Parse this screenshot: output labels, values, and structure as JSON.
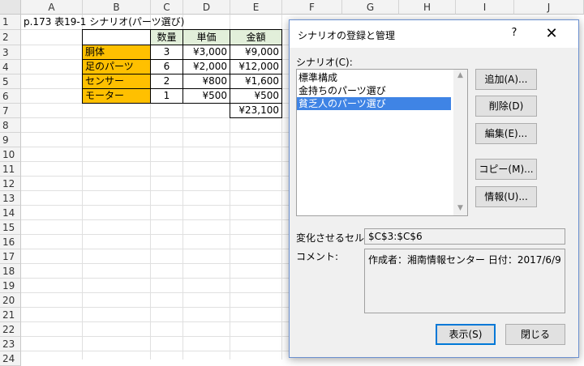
{
  "sheet": {
    "columns": [
      "A",
      "B",
      "C",
      "D",
      "E",
      "F",
      "G",
      "H",
      "I",
      "J"
    ],
    "rows": [
      "1",
      "2",
      "3",
      "4",
      "5",
      "6",
      "7",
      "8",
      "9",
      "10",
      "11",
      "12",
      "13",
      "14",
      "15",
      "16",
      "17",
      "18",
      "19",
      "20",
      "21",
      "22",
      "23",
      "24"
    ],
    "a1": "p.173 表19-1 シナリオ(パーツ選び)",
    "headers": {
      "qty": "数量",
      "price": "単価",
      "amount": "金額"
    },
    "items": [
      {
        "name": "胴体",
        "qty": "3",
        "price": "¥3,000",
        "amount": "¥9,000"
      },
      {
        "name": "足のパーツ",
        "qty": "6",
        "price": "¥2,000",
        "amount": "¥12,000"
      },
      {
        "name": "センサー",
        "qty": "2",
        "price": "¥800",
        "amount": "¥1,600"
      },
      {
        "name": "モーター",
        "qty": "1",
        "price": "¥500",
        "amount": "¥500"
      }
    ],
    "total": "¥23,100",
    "colors": {
      "name_fill": "#ffc000",
      "header_fill": "#e2efda"
    }
  },
  "dialog": {
    "title": "シナリオの登録と管理",
    "help": "?",
    "close": "✕",
    "scenario_label": "シナリオ(C):",
    "scenarios": [
      "標準構成",
      "金持ちのパーツ選び",
      "貧乏人のパーツ選び"
    ],
    "selected_index": 2,
    "buttons": {
      "add": "追加(A)...",
      "delete": "削除(D)",
      "edit": "編集(E)...",
      "copy": "コピー(M)...",
      "info": "情報(U)...",
      "show": "表示(S)",
      "close": "閉じる"
    },
    "changing_cells_label": "変化させるセル:",
    "changing_cells_value": "$C$3:$C$6",
    "comment_label": "コメント:",
    "comment_value": "作成者：湘南情報センター 日付：2017/6/9",
    "scroll_up": "▲",
    "scroll_down": "▼"
  }
}
